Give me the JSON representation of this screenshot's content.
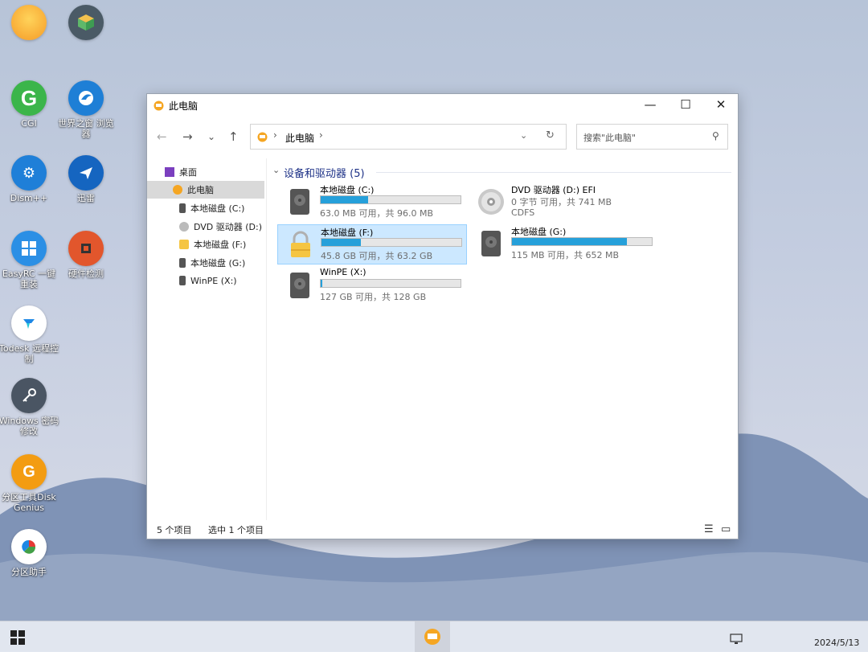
{
  "desktop": {
    "icons": [
      {
        "label": ""
      },
      {
        "label": ""
      },
      {
        "label": "CGI"
      },
      {
        "label": "世界之窗 浏览器"
      },
      {
        "label": "Dism++"
      },
      {
        "label": "迅雷"
      },
      {
        "label": "EasyRC 一键重装"
      },
      {
        "label": "硬件检测"
      },
      {
        "label": "Todesk 远程控制"
      },
      {
        "label": "Windows 密码修改"
      },
      {
        "label": "分区工具DiskGenius"
      },
      {
        "label": "分区助手"
      }
    ]
  },
  "window": {
    "title": "此电脑",
    "minimize_glyph": "—",
    "maximize_glyph": "☐",
    "close_glyph": "✕"
  },
  "nav": {
    "back": "←",
    "forward": "→",
    "recent": "⌄",
    "up": "↑",
    "breadcrumb": "此电脑",
    "search_placeholder": "搜索\"此电脑\""
  },
  "sidebar": {
    "items": [
      {
        "label": "桌面"
      },
      {
        "label": "此电脑"
      },
      {
        "label": "本地磁盘 (C:)"
      },
      {
        "label": "DVD 驱动器 (D:)"
      },
      {
        "label": "本地磁盘 (F:)"
      },
      {
        "label": "本地磁盘 (G:)"
      },
      {
        "label": "WinPE (X:)"
      }
    ]
  },
  "content": {
    "group_title": "设备和驱动器 (5)",
    "drives": [
      {
        "name": "本地磁盘 (C:)",
        "usage": "63.0 MB 可用，共 96.0 MB",
        "used_fraction": 0.34
      },
      {
        "name": "DVD 驱动器 (D:) EFI",
        "usage": "0 字节 可用，共 741 MB",
        "fs": "CDFS"
      },
      {
        "name": "本地磁盘 (F:)",
        "usage": "45.8 GB 可用，共 63.2 GB",
        "used_fraction": 0.28
      },
      {
        "name": "本地磁盘 (G:)",
        "usage": "115 MB 可用，共 652 MB",
        "used_fraction": 0.82
      },
      {
        "name": "WinPE (X:)",
        "usage": "127 GB 可用，共 128 GB",
        "used_fraction": 0.01
      }
    ]
  },
  "statusbar": {
    "count": "5 个项目",
    "selection": "选中 1 个项目"
  },
  "taskbar": {
    "date": "2024/5/13"
  },
  "colors": {
    "accent": "#26a0da",
    "selection": "#cce8ff"
  }
}
